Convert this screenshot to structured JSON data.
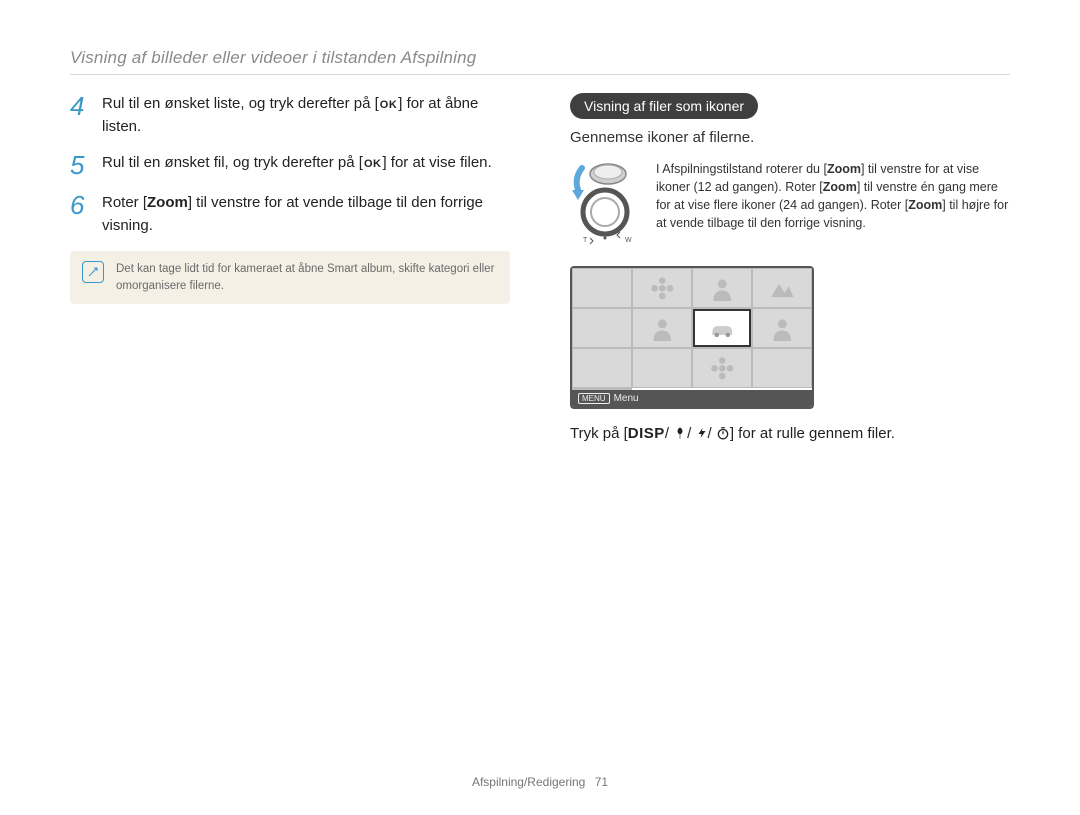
{
  "page_title": "Visning af billeder eller videoer i tilstanden Afspilning",
  "steps": [
    {
      "num": "4",
      "pre": "Rul til en ønsket liste, og tryk derefter på [",
      "ok": "OK",
      "post": "] for at åbne listen."
    },
    {
      "num": "5",
      "pre": "Rul til en ønsket fil, og tryk derefter på [",
      "ok": "OK",
      "post": "] for at  vise filen."
    },
    {
      "num": "6",
      "pre": "Roter [",
      "bold": "Zoom",
      "post": "] til venstre for at vende tilbage til den forrige visning."
    }
  ],
  "note": "Det kan tage lidt tid for kameraet at åbne Smart album, skifte kategori eller omorganisere filerne.",
  "right": {
    "pill": "Visning af filer som ikoner",
    "sub": "Gennemse ikoner af filerne.",
    "zoom": {
      "p1a": "I Afspilningstilstand roterer du [",
      "z1": "Zoom",
      "p1b": "] til venstre for at vise ikoner (12 ad gangen). Roter [",
      "z2": "Zoom",
      "p1c": "] til venstre én gang mere for at vise flere ikoner (24 ad gangen). Roter [",
      "z3": "Zoom",
      "p1d": "] til højre for at vende tilbage til den forrige visning."
    },
    "menu_label": "Menu",
    "caption_pre": "Tryk på [",
    "caption_disp": "DISP",
    "caption_post": "] for at rulle gennem filer.",
    "dial_labels": {
      "t": "T",
      "w": "W"
    }
  },
  "footer": {
    "section": "Afspilning/Redigering",
    "page": "71"
  }
}
